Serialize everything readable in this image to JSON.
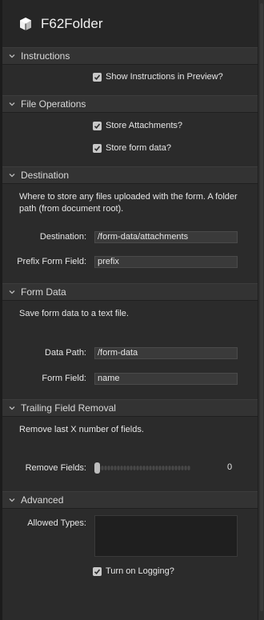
{
  "app": {
    "title": "F62Folder",
    "icon": "cube-icon"
  },
  "sections": {
    "instructions": {
      "label": "Instructions",
      "show_preview_label": "Show Instructions in Preview?",
      "show_preview_checked": true
    },
    "file_ops": {
      "label": "File Operations",
      "store_attachments_label": "Store Attachments?",
      "store_attachments_checked": true,
      "store_form_data_label": "Store form data?",
      "store_form_data_checked": true
    },
    "destination": {
      "label": "Destination",
      "description": "Where to store any files uploaded with the form. A folder path (from document root).",
      "destination_label": "Destination:",
      "destination_value": "/form-data/attachments",
      "prefix_label": "Prefix Form Field:",
      "prefix_value": "prefix"
    },
    "form_data": {
      "label": "Form Data",
      "description": "Save form data to a text file.",
      "data_path_label": "Data Path:",
      "data_path_value": "/form-data",
      "form_field_label": "Form Field:",
      "form_field_value": "name"
    },
    "trailing": {
      "label": "Trailing Field Removal",
      "description": "Remove last X number of fields.",
      "remove_fields_label": "Remove Fields:",
      "remove_fields_value": "0",
      "slider_level": 0
    },
    "advanced": {
      "label": "Advanced",
      "allowed_types_label": "Allowed Types:",
      "allowed_types_value": "",
      "logging_label": "Turn on Logging?",
      "logging_checked": true
    }
  }
}
